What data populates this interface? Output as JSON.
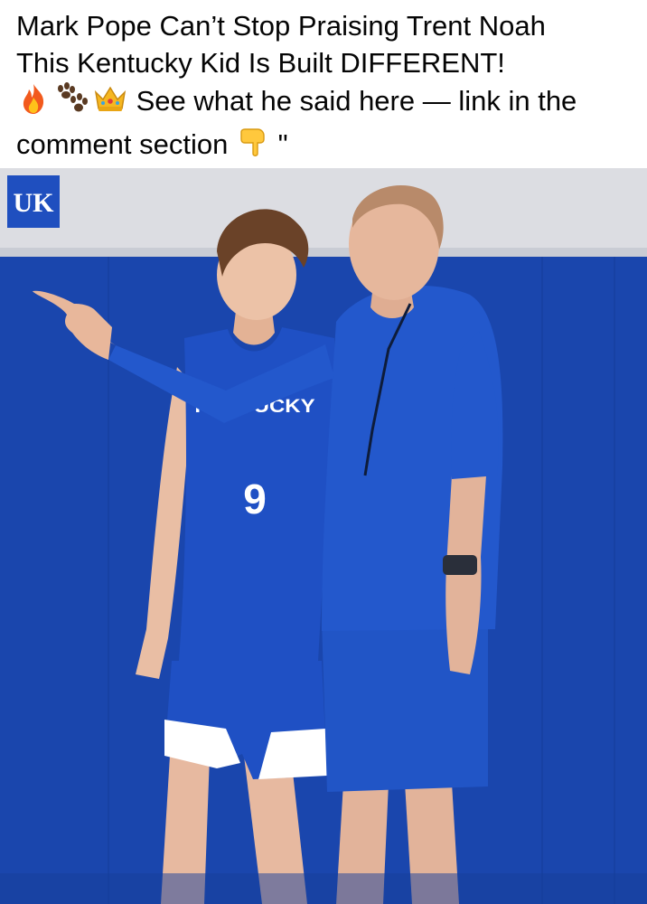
{
  "post": {
    "caption_line1": "Mark Pope Can’t Stop Praising Trent Noah",
    "caption_line2": "This Kentucky Kid Is Built DIFFERENT!",
    "caption_line3_text": "See what he said here — link in the",
    "caption_line4_text": "comment section",
    "caption_line4_tail": "\"",
    "emojis": [
      "fire-icon",
      "paw-prints-icon",
      "crown-icon",
      "pointing-down-icon"
    ]
  },
  "photo": {
    "logo_text": "UK",
    "jersey_text": "KENTUCKY",
    "jersey_number": "9",
    "colors": {
      "kentucky_blue": "#1f4fbf",
      "wall_blue": "#1a46ad",
      "upper_wall": "#dcdde2",
      "floor": "#163d9a"
    }
  }
}
